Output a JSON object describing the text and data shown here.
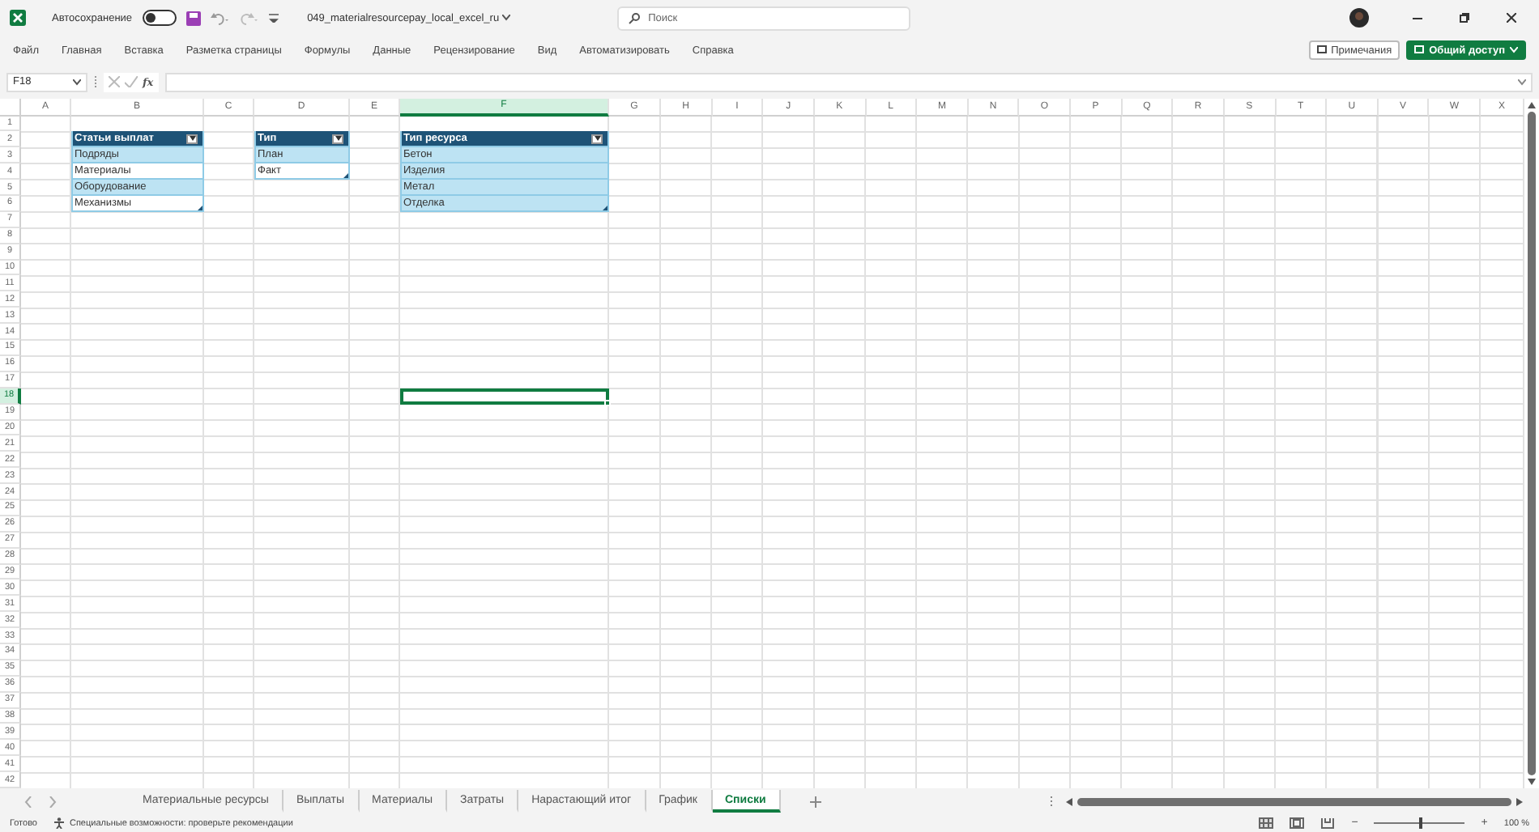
{
  "title_bar": {
    "autosave": {
      "label": "Автосохранение",
      "on": false
    },
    "filename": "049_materialresourcepay_local_excel_ru",
    "search_placeholder": "Поиск"
  },
  "ribbon_tabs": [
    "Файл",
    "Главная",
    "Вставка",
    "Разметка страницы",
    "Формулы",
    "Данные",
    "Рецензирование",
    "Вид",
    "Автоматизировать",
    "Справка"
  ],
  "ribbon_buttons": [
    {
      "label": "Примечания",
      "kind": "outline"
    },
    {
      "label": "Общий доступ",
      "kind": "primary"
    }
  ],
  "formula_bar": {
    "name_box": "F18",
    "function_label": "fx"
  },
  "grid": {
    "columns": [
      {
        "label": "A",
        "selected": false
      },
      {
        "label": "B",
        "selected": false
      },
      {
        "label": "C",
        "selected": false
      },
      {
        "label": "D",
        "selected": false
      },
      {
        "label": "E",
        "selected": false
      },
      {
        "label": "F",
        "selected": true
      },
      {
        "label": "G",
        "selected": false
      },
      {
        "label": "H",
        "selected": false
      },
      {
        "label": "I",
        "selected": false
      },
      {
        "label": "J",
        "selected": false
      },
      {
        "label": "K",
        "selected": false
      },
      {
        "label": "L",
        "selected": false
      },
      {
        "label": "M",
        "selected": false
      },
      {
        "label": "N",
        "selected": false
      },
      {
        "label": "O",
        "selected": false
      },
      {
        "label": "P",
        "selected": false
      },
      {
        "label": "Q",
        "selected": false
      },
      {
        "label": "R",
        "selected": false
      },
      {
        "label": "S",
        "selected": false
      },
      {
        "label": "T",
        "selected": false
      },
      {
        "label": "U",
        "selected": false
      },
      {
        "label": "V",
        "selected": false
      },
      {
        "label": "W",
        "selected": false
      },
      {
        "label": "X",
        "selected": false
      }
    ],
    "rows": [
      {
        "label": "1",
        "selected": false
      },
      {
        "label": "2",
        "selected": false
      },
      {
        "label": "3",
        "selected": false
      },
      {
        "label": "4",
        "selected": false
      },
      {
        "label": "5",
        "selected": false
      },
      {
        "label": "6",
        "selected": false
      },
      {
        "label": "7",
        "selected": false
      },
      {
        "label": "8",
        "selected": false
      },
      {
        "label": "9",
        "selected": false
      },
      {
        "label": "10",
        "selected": false
      },
      {
        "label": "11",
        "selected": false
      },
      {
        "label": "12",
        "selected": false
      },
      {
        "label": "13",
        "selected": false
      },
      {
        "label": "14",
        "selected": false
      },
      {
        "label": "15",
        "selected": false
      },
      {
        "label": "16",
        "selected": false
      },
      {
        "label": "17",
        "selected": false
      },
      {
        "label": "18",
        "selected": true
      },
      {
        "label": "19",
        "selected": false
      },
      {
        "label": "20",
        "selected": false
      },
      {
        "label": "21",
        "selected": false
      },
      {
        "label": "22",
        "selected": false
      },
      {
        "label": "23",
        "selected": false
      },
      {
        "label": "24",
        "selected": false
      },
      {
        "label": "25",
        "selected": false
      },
      {
        "label": "26",
        "selected": false
      },
      {
        "label": "27",
        "selected": false
      },
      {
        "label": "28",
        "selected": false
      },
      {
        "label": "29",
        "selected": false
      },
      {
        "label": "30",
        "selected": false
      },
      {
        "label": "31",
        "selected": false
      },
      {
        "label": "32",
        "selected": false
      },
      {
        "label": "33",
        "selected": false
      },
      {
        "label": "34",
        "selected": false
      },
      {
        "label": "35",
        "selected": false
      },
      {
        "label": "36",
        "selected": false
      },
      {
        "label": "37",
        "selected": false
      },
      {
        "label": "38",
        "selected": false
      },
      {
        "label": "39",
        "selected": false
      },
      {
        "label": "40",
        "selected": false
      },
      {
        "label": "41",
        "selected": false
      },
      {
        "label": "42",
        "selected": false
      }
    ],
    "tables": [
      {
        "header": "Статьи выплат",
        "items": [
          {
            "text": "Подряды",
            "shaded": true
          },
          {
            "text": "Материалы",
            "shaded": false
          },
          {
            "text": "Оборудование",
            "shaded": true
          },
          {
            "text": "Механизмы",
            "shaded": false
          }
        ]
      },
      {
        "header": "Тип",
        "items": [
          {
            "text": "План",
            "shaded": true
          },
          {
            "text": "Факт",
            "shaded": false
          }
        ]
      },
      {
        "header": "Тип ресурса",
        "items": [
          {
            "text": "Бетон",
            "shaded": true
          },
          {
            "text": "Изделия",
            "shaded": true
          },
          {
            "text": "Метал",
            "shaded": true
          },
          {
            "text": "Отделка",
            "shaded": true
          }
        ]
      }
    ]
  },
  "sheet_tabs": [
    {
      "label": "Материальные ресурсы",
      "selected": false
    },
    {
      "label": "Выплаты",
      "selected": false
    },
    {
      "label": "Материалы",
      "selected": false
    },
    {
      "label": "Затраты",
      "selected": false
    },
    {
      "label": "Нарастающий итог",
      "selected": false
    },
    {
      "label": "График",
      "selected": false
    },
    {
      "label": "Списки",
      "selected": true
    }
  ],
  "status_bar": {
    "ready": "Готово",
    "accessibility": "Специальные возможности: проверьте рекомендации",
    "zoom_out": "−",
    "zoom_slider": {
      "level": 0.5
    },
    "zoom_in": "+",
    "zoom": "100 %"
  }
}
